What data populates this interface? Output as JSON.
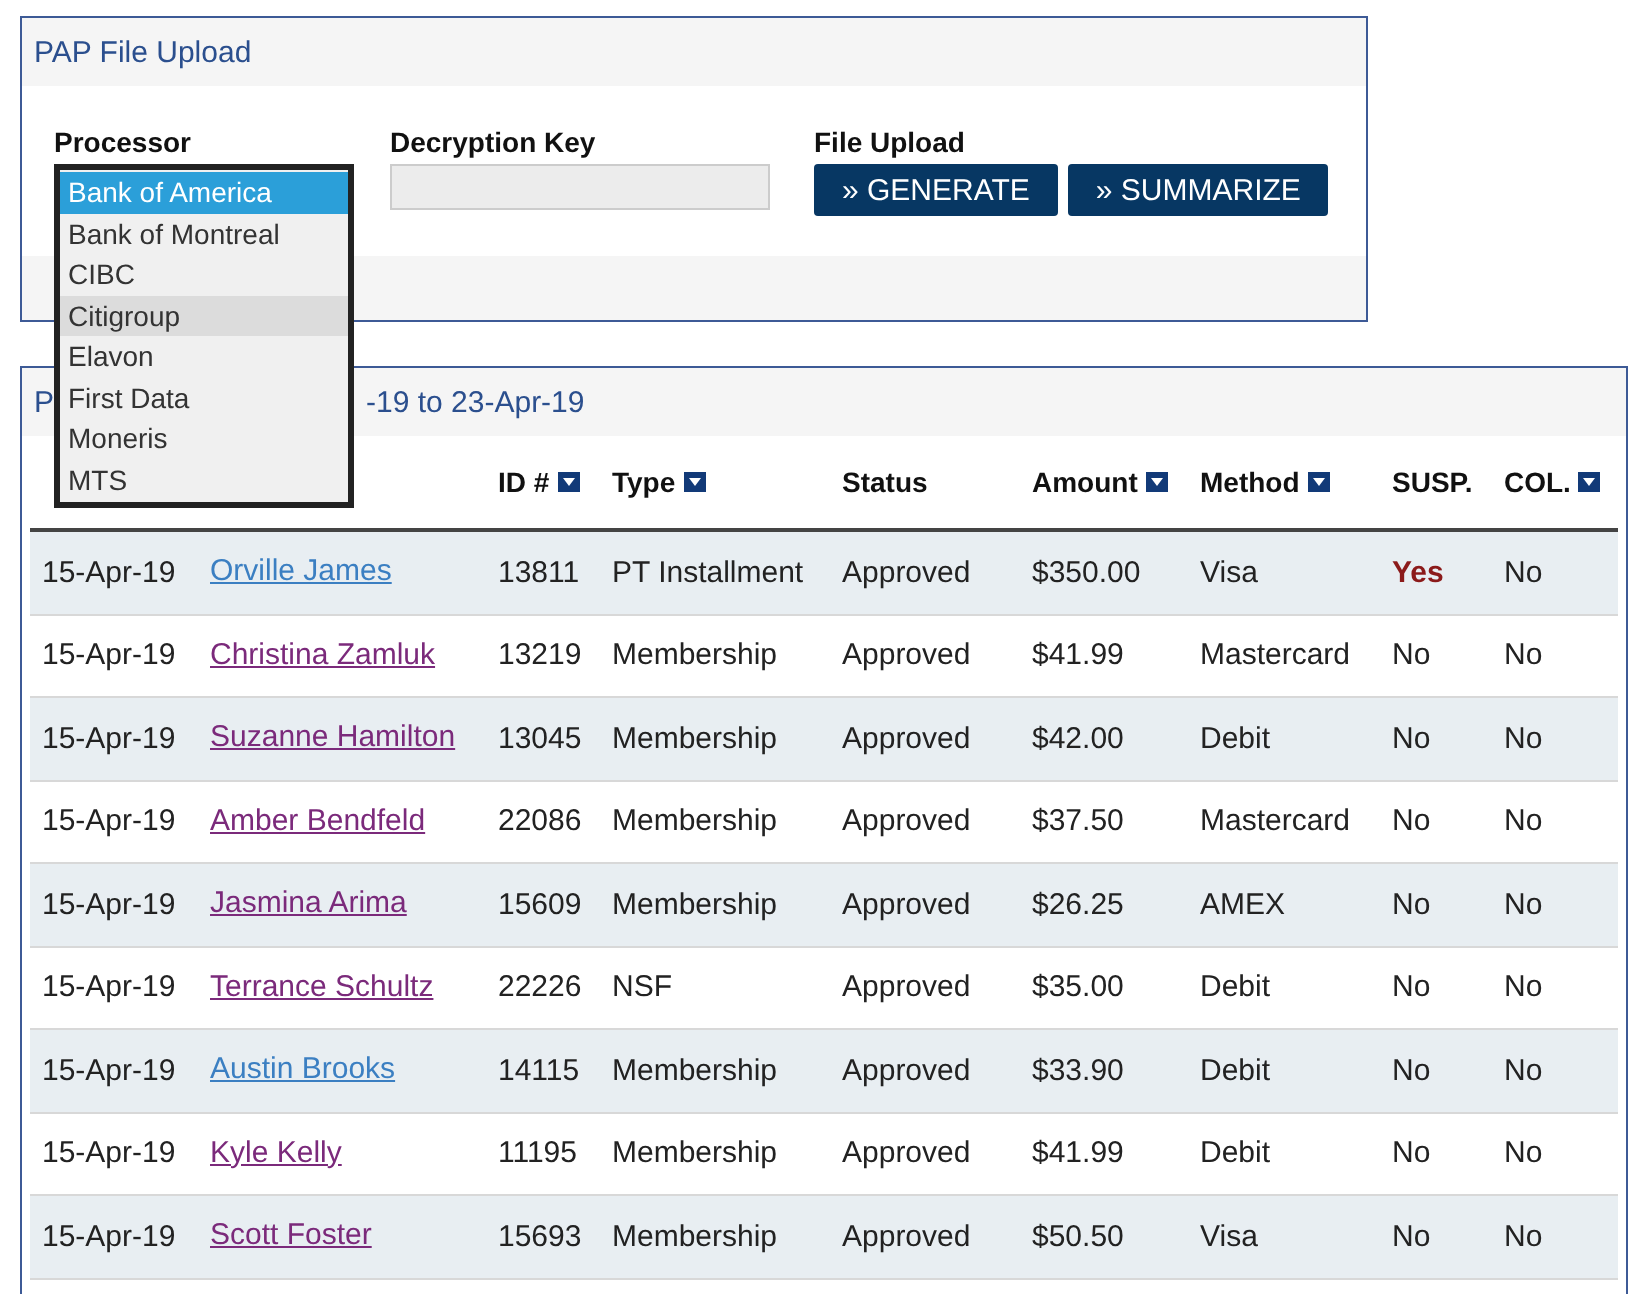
{
  "upload_panel": {
    "title": "PAP File Upload",
    "fields": [
      {
        "label": "Processor",
        "kind": "select"
      },
      {
        "label": "Decryption Key",
        "kind": "input"
      },
      {
        "label": "File Upload",
        "kind": "buttons"
      }
    ],
    "buttons": [
      "» GENERATE",
      "» SUMMARIZE"
    ],
    "processor_options": [
      {
        "label": "Bank of America",
        "selected": true,
        "highlighted": false
      },
      {
        "label": "Bank of Montreal",
        "selected": false,
        "highlighted": false
      },
      {
        "label": "CIBC",
        "selected": false,
        "highlighted": false
      },
      {
        "label": "Citigroup",
        "selected": false,
        "highlighted": true
      },
      {
        "label": "Elavon",
        "selected": false,
        "highlighted": false
      },
      {
        "label": "First Data",
        "selected": false,
        "highlighted": false
      },
      {
        "label": "Moneris",
        "selected": false,
        "highlighted": false
      },
      {
        "label": "MTS",
        "selected": false,
        "highlighted": false
      }
    ]
  },
  "results_panel": {
    "title_start": "P",
    "title_end": "-19 to 23-Apr-19",
    "columns": [
      {
        "label": "ID #",
        "sortable": true
      },
      {
        "label": "Type",
        "sortable": true
      },
      {
        "label": "Status",
        "sortable": false
      },
      {
        "label": "Amount",
        "sortable": true
      },
      {
        "label": "Method",
        "sortable": true
      },
      {
        "label": "SUSP.",
        "sortable": false
      },
      {
        "label": "COL.",
        "sortable": true
      }
    ],
    "rows": [
      {
        "date": "15-Apr-19",
        "name": "Orville James",
        "visited": false,
        "id": "13811",
        "type": "PT Installment",
        "status": "Approved",
        "amount": "$350.00",
        "method": "Visa",
        "susp": "Yes",
        "suspicious": true,
        "col": "No"
      },
      {
        "date": "15-Apr-19",
        "name": "Christina Zamluk",
        "visited": true,
        "id": "13219",
        "type": "Membership",
        "status": "Approved",
        "amount": "$41.99",
        "method": "Mastercard",
        "susp": "No",
        "suspicious": false,
        "col": "No"
      },
      {
        "date": "15-Apr-19",
        "name": "Suzanne Hamilton",
        "visited": true,
        "id": "13045",
        "type": "Membership",
        "status": "Approved",
        "amount": "$42.00",
        "method": "Debit",
        "susp": "No",
        "suspicious": false,
        "col": "No"
      },
      {
        "date": "15-Apr-19",
        "name": "Amber Bendfeld",
        "visited": true,
        "id": "22086",
        "type": "Membership",
        "status": "Approved",
        "amount": "$37.50",
        "method": "Mastercard",
        "susp": "No",
        "suspicious": false,
        "col": "No"
      },
      {
        "date": "15-Apr-19",
        "name": "Jasmina Arima",
        "visited": true,
        "id": "15609",
        "type": "Membership",
        "status": "Approved",
        "amount": "$26.25",
        "method": "AMEX",
        "susp": "No",
        "suspicious": false,
        "col": "No"
      },
      {
        "date": "15-Apr-19",
        "name": "Terrance Schultz",
        "visited": true,
        "id": "22226",
        "type": "NSF",
        "status": "Approved",
        "amount": "$35.00",
        "method": "Debit",
        "susp": "No",
        "suspicious": false,
        "col": "No"
      },
      {
        "date": "15-Apr-19",
        "name": "Austin Brooks",
        "visited": false,
        "id": "14115",
        "type": "Membership",
        "status": "Approved",
        "amount": "$33.90",
        "method": "Debit",
        "susp": "No",
        "suspicious": false,
        "col": "No"
      },
      {
        "date": "15-Apr-19",
        "name": "Kyle Kelly",
        "visited": true,
        "id": "11195",
        "type": "Membership",
        "status": "Approved",
        "amount": "$41.99",
        "method": "Debit",
        "susp": "No",
        "suspicious": false,
        "col": "No"
      },
      {
        "date": "15-Apr-19",
        "name": "Scott Foster",
        "visited": true,
        "id": "15693",
        "type": "Membership",
        "status": "Approved",
        "amount": "$50.50",
        "method": "Visa",
        "susp": "No",
        "suspicious": false,
        "col": "No"
      }
    ]
  }
}
